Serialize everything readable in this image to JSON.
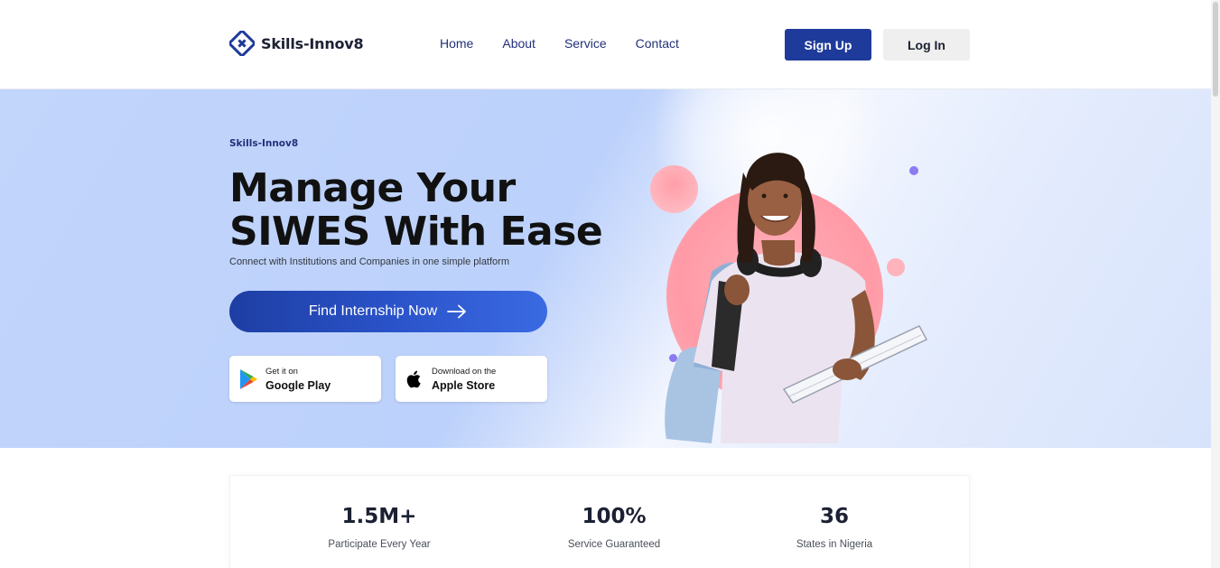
{
  "brand": {
    "name": "Skills-Innov8",
    "accent": "#1e3a9a"
  },
  "nav": {
    "items": [
      "Home",
      "About",
      "Service",
      "Contact"
    ]
  },
  "auth": {
    "signup_label": "Sign Up",
    "login_label": "Log In"
  },
  "hero": {
    "eyebrow": "Skills-Innov8",
    "headline_line1": "Manage Your",
    "headline_line2": "SIWES With Ease",
    "subheadline": "Connect with Institutions and Companies in one simple platform",
    "cta_label": "Find Internship Now",
    "stores": [
      {
        "small": "Get it on",
        "big": "Google Play",
        "icon": "google-play-icon"
      },
      {
        "small": "Download on the",
        "big": "Apple Store",
        "icon": "apple-icon"
      }
    ]
  },
  "stats": [
    {
      "value": "1.5M+",
      "label": "Participate Every Year"
    },
    {
      "value": "100%",
      "label": "Service Guaranteed"
    },
    {
      "value": "36",
      "label": "States in Nigeria"
    }
  ]
}
